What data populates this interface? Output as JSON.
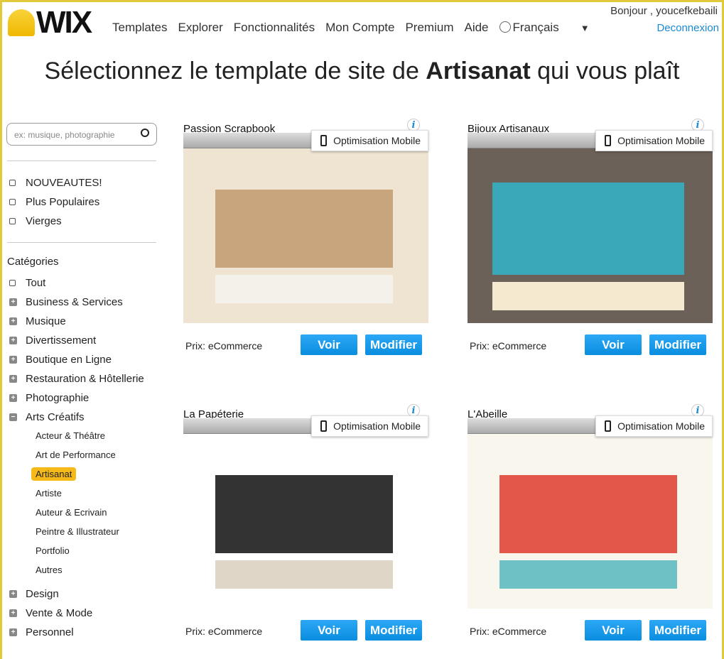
{
  "header": {
    "logo": "WIX",
    "nav": [
      "Templates",
      "Explorer",
      "Fonctionnalités",
      "Mon Compte",
      "Premium",
      "Aide"
    ],
    "language": "Français",
    "language_caret": "▼",
    "greeting": "Bonjour , youcefkebaili",
    "logout": "Deconnexion"
  },
  "page_title": {
    "prefix": "Sélectionnez le template de site de ",
    "bold": "Artisanat",
    "suffix": " qui vous plaît"
  },
  "sidebar": {
    "search_placeholder": "ex: musique, photographie",
    "filters": [
      "NOUVEAUTES!",
      "Plus Populaires",
      "Vierges"
    ],
    "categories_label": "Catégories",
    "categories": [
      {
        "label": "Tout",
        "icon": "checkbox"
      },
      {
        "label": "Business & Services",
        "icon": "plus"
      },
      {
        "label": "Musique",
        "icon": "plus"
      },
      {
        "label": "Divertissement",
        "icon": "plus"
      },
      {
        "label": "Boutique en Ligne",
        "icon": "plus"
      },
      {
        "label": "Restauration & Hôtellerie",
        "icon": "plus"
      },
      {
        "label": "Photographie",
        "icon": "plus"
      },
      {
        "label": "Arts Créatifs",
        "icon": "minus"
      }
    ],
    "subcategories": [
      "Acteur & Théâtre",
      "Art de Performance",
      "Artisanat",
      "Artiste",
      "Auteur & Ecrivain",
      "Peintre & Illustrateur",
      "Portfolio",
      "Autres"
    ],
    "selected_subcategory": "Artisanat",
    "more_categories": [
      "Design",
      "Vente & Mode",
      "Personnel"
    ]
  },
  "templates": [
    {
      "name": "Passion Scrapbook",
      "badge": "Optimisation Mobile",
      "price": "Prix: eCommerce",
      "view": "Voir",
      "edit": "Modifier",
      "info": "i",
      "colors": [
        "#efe4d2",
        "#c9a57d",
        "#f4f0ea"
      ]
    },
    {
      "name": "Bijoux Artisanaux",
      "badge": "Optimisation Mobile",
      "price": "Prix: eCommerce",
      "view": "Voir",
      "edit": "Modifier",
      "info": "i",
      "colors": [
        "#6b6158",
        "#3aa8b8",
        "#f5ead0"
      ]
    },
    {
      "name": "La Papéterie",
      "badge": "Optimisation Mobile",
      "price": "Prix: eCommerce",
      "view": "Voir",
      "edit": "Modifier",
      "info": "i",
      "colors": [
        "#ffffff",
        "#333333",
        "#e0d6c8"
      ]
    },
    {
      "name": "L'Abeille",
      "badge": "Optimisation Mobile",
      "price": "Prix: eCommerce",
      "view": "Voir",
      "edit": "Modifier",
      "info": "i",
      "colors": [
        "#f9f6ee",
        "#e3574b",
        "#6ec1c4"
      ]
    }
  ],
  "colors": {
    "accent": "#1a8ad4",
    "button": "#0a8de0",
    "selected": "#f5b91a",
    "border": "#e2c93a"
  }
}
